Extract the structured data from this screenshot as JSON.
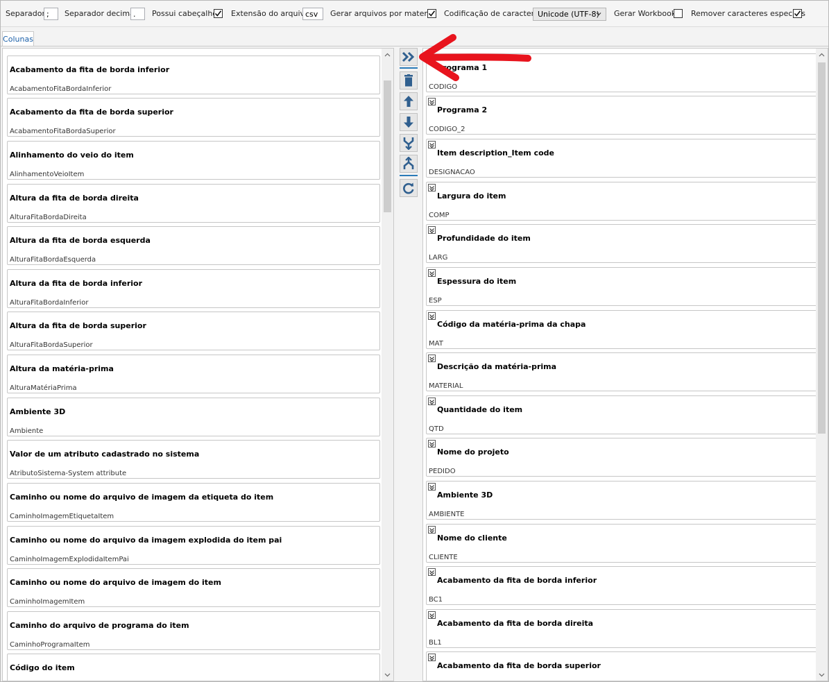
{
  "toolbar": {
    "separator_label": "Separador",
    "separator_value": ";",
    "decimal_label": "Separador decimal",
    "decimal_value": ".",
    "header_label": "Possui cabeçalho",
    "header_checked": true,
    "extension_label": "Extensão do arquivo",
    "extension_value": "csv",
    "per_material_label": "Gerar arquivos por material",
    "per_material_checked": true,
    "encoding_label": "Codificação de caracteres",
    "encoding_value": "Unicode (UTF-8)",
    "workbook_label": "Gerar Workbook",
    "workbook_checked": false,
    "remove_special_label": "Remover caracteres especiais",
    "remove_special_checked": true
  },
  "tab": {
    "label": "Colunas"
  },
  "available_columns": [
    {
      "title": "Acabamento da fita de borda inferior",
      "code": "AcabamentoFitaBordaInferior"
    },
    {
      "title": "Acabamento da fita de borda superior",
      "code": "AcabamentoFitaBordaSuperior"
    },
    {
      "title": "Alinhamento do veio do item",
      "code": "AlinhamentoVeioItem"
    },
    {
      "title": "Altura da fita de borda direita",
      "code": "AlturaFitaBordaDireita"
    },
    {
      "title": "Altura da fita de borda esquerda",
      "code": "AlturaFitaBordaEsquerda"
    },
    {
      "title": "Altura da fita de borda inferior",
      "code": "AlturaFitaBordaInferior"
    },
    {
      "title": "Altura da fita de borda superior",
      "code": "AlturaFitaBordaSuperior"
    },
    {
      "title": "Altura da matéria-prima",
      "code": "AlturaMatériaPrima"
    },
    {
      "title": "Ambiente 3D",
      "code": "Ambiente"
    },
    {
      "title": "Valor de um atributo cadastrado no sistema",
      "code": "AtributoSistema-System attribute"
    },
    {
      "title": "Caminho ou nome do arquivo de imagem da etiqueta do item",
      "code": "CaminhoImagemEtiquetaItem"
    },
    {
      "title": "Caminho ou nome do arquivo da imagem explodida do item pai",
      "code": "CaminhoImagemExplodidaItemPai"
    },
    {
      "title": "Caminho ou nome do arquivo de imagem do item",
      "code": "CaminhoImagemItem"
    },
    {
      "title": "Caminho do arquivo de programa do item",
      "code": "CaminhoProgramaItem"
    },
    {
      "title": "Código do item",
      "code": ""
    }
  ],
  "selected_columns": [
    {
      "title": "Programa 1",
      "code": "CODIGO"
    },
    {
      "title": "Programa 2",
      "code": "CODIGO_2"
    },
    {
      "title": "Item description_Item code",
      "code": "DESIGNACAO"
    },
    {
      "title": "Largura do item",
      "code": "COMP"
    },
    {
      "title": "Profundidade do item",
      "code": "LARG"
    },
    {
      "title": "Espessura do item",
      "code": "ESP"
    },
    {
      "title": "Código da matéria-prima da chapa",
      "code": "MAT"
    },
    {
      "title": "Descrição da matéria-prima",
      "code": "MATERIAL"
    },
    {
      "title": "Quantidade do item",
      "code": "QTD"
    },
    {
      "title": "Nome do projeto",
      "code": "PEDIDO"
    },
    {
      "title": "Ambiente 3D",
      "code": "AMBIENTE"
    },
    {
      "title": "Nome do cliente",
      "code": "CLIENTE"
    },
    {
      "title": "Acabamento da fita de borda inferior",
      "code": "BC1"
    },
    {
      "title": "Acabamento da fita de borda direita",
      "code": "BL1"
    },
    {
      "title": "Acabamento da fita de borda superior",
      "code": ""
    }
  ],
  "actions": [
    "add-all",
    "delete",
    "move-up",
    "move-down",
    "merge",
    "split",
    "refresh"
  ],
  "colors": {
    "accent": "#1a5fa8",
    "button_icon": "#2f5f8f",
    "annotation_arrow": "#e8141d"
  }
}
